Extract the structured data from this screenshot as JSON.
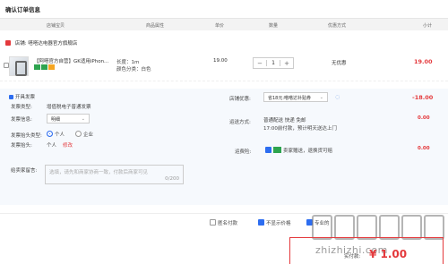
{
  "title": "确认订单信息",
  "columns": [
    "店铺宝贝",
    "商品属性",
    "单价",
    "数量",
    "优惠方式",
    "小计"
  ],
  "store": {
    "label": "店铺:",
    "name": "嗒嗒达电器官方旗舰店"
  },
  "item": {
    "name": "【阿嗒官方自营】GK适用iPhon...",
    "attr_length": "长度：1m",
    "attr_color": "颜色分类：白色",
    "price": "19.00",
    "qty": "1",
    "minus": "−",
    "plus": "+",
    "discount": "无优惠",
    "subtotal": "19.00"
  },
  "invoice": {
    "header": "开具发票",
    "type_label": "发票类型:",
    "type_value": "增值税电子普通发票",
    "content_label": "发票信息:",
    "content_value": "明细",
    "title_type_label": "发票抬头类型:",
    "opt_personal": "个人",
    "opt_company": "企业",
    "title_label": "发票抬头:",
    "title_value": "个人",
    "modify": "修改"
  },
  "remark": {
    "label": "给卖家留言:",
    "placeholder": "选填，请先和商家协商一致，付款后商家可见",
    "count": "0/200"
  },
  "right": {
    "promo_label": "店铺优惠:",
    "promo_value": "省18元:嗒嗒达补贴券",
    "promo_amount": "-18.00",
    "ship_label": "运送方式:",
    "ship_line1": "普通配送 快递 免邮",
    "ship_line2": "17:00前付款，预计明天送达上门",
    "ship_amount": "0.00",
    "ins_label": "运费险:",
    "ins_text": "卖家赠送，退换货可赔",
    "ins_amount": "0.00"
  },
  "bottom": {
    "anon": "匿名付款",
    "noprice": "不显示价格",
    "more": "专业的"
  },
  "total": {
    "label": "实付款:",
    "value": "¥ 1.00"
  },
  "colors": {
    "accent": "#e4393c",
    "blue": "#2d6df0"
  }
}
